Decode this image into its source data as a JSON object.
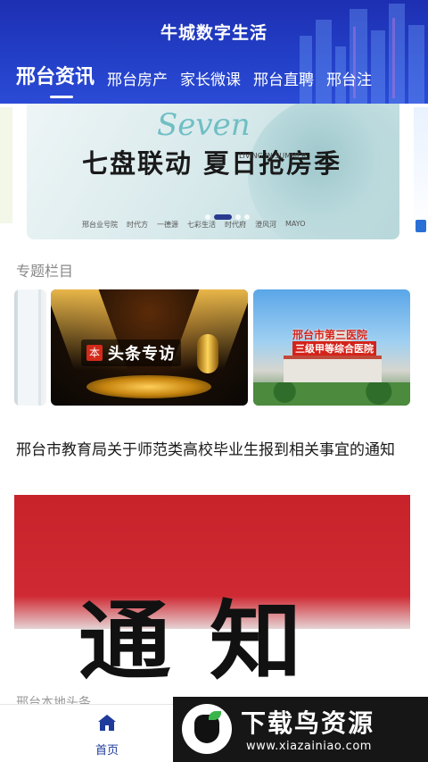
{
  "app": {
    "title": "牛城数字生活"
  },
  "tabs": [
    {
      "label": "邢台资讯",
      "active": true
    },
    {
      "label": "邢台房产",
      "active": false
    },
    {
      "label": "家长微课",
      "active": false
    },
    {
      "label": "邢台直聘",
      "active": false
    },
    {
      "label": "邢台注",
      "active": false
    }
  ],
  "banner": {
    "script_text": "Seven",
    "headline": "七盘联动 夏日抢房季",
    "sub_text": "LIVING IN SUMMER",
    "logos": [
      "邢台业号院",
      "时代方",
      "一德源",
      "七彩生活",
      "时代府",
      "澄风河",
      "MAYO"
    ],
    "slides": 4,
    "active_slide": 1
  },
  "special_section": {
    "title": "专题栏目",
    "cards": [
      {
        "name": "doctor"
      },
      {
        "name": "headline-interview",
        "badge_icon": "本",
        "badge_text": "头条专访"
      },
      {
        "name": "third-hospital",
        "title_line1": "邢台市第三医院",
        "title_line2": "三级甲等综合医院"
      }
    ]
  },
  "article": {
    "title": "邢台市教育局关于师范类高校毕业生报到相关事宜的通知",
    "image_text": "通知",
    "source": "邢台本地头条"
  },
  "bottom_nav": {
    "home_label": "首页",
    "home_icon": "home-icon",
    "accent": "#1e3a9a"
  },
  "watermark": {
    "title": "下载鸟资源",
    "url": "www.xiazainiao.com"
  },
  "colors": {
    "header": "#2340c8",
    "notice_red": "#c8222b"
  }
}
